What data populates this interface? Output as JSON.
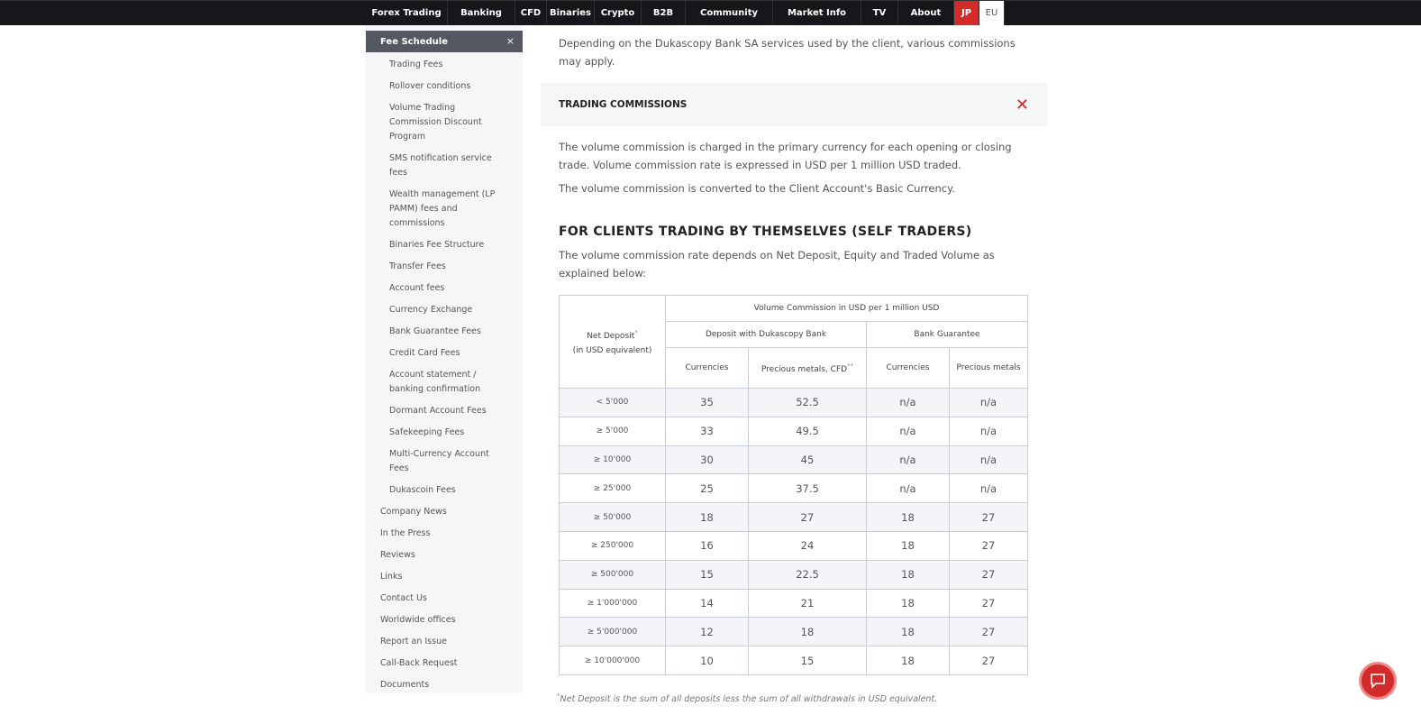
{
  "nav": [
    "Forex Trading",
    "Banking",
    "CFD",
    "Binaries",
    "Crypto",
    "B2B",
    "Community",
    "Market Info",
    "TV",
    "About",
    "JP",
    "EU"
  ],
  "sidebar": {
    "section": "Fee Schedule",
    "close": "×",
    "sub": [
      "Trading Fees",
      "Rollover conditions",
      "Volume Trading Commission Discount Program",
      "SMS notification service fees",
      "Wealth management (LP PAMM) fees and commissions",
      "Binaries Fee Structure",
      "Transfer Fees",
      "Account fees",
      "Currency Exchange",
      "Bank Guarantee Fees",
      "Credit Card Fees",
      "Account statement / banking confirmation",
      "Dormant Account Fees",
      "Safekeeping Fees",
      "Multi-Currency Account Fees",
      "Dukascoin Fees"
    ],
    "top": [
      "Company News",
      "In the Press",
      "Reviews",
      "Links",
      "Contact Us",
      "Worldwide offices",
      "Report an Issue",
      "Call-Back Request",
      "Documents"
    ]
  },
  "intro": "Depending on the Dukascopy Bank SA services used by the client, various commissions may apply.",
  "accordion": {
    "title": "TRADING COMMISSIONS"
  },
  "p1": "The volume commission is charged in the primary currency for each opening or closing trade. Volume commission rate is expressed in USD per 1 million USD traded.",
  "p2": "The volume commission is converted to the Client Account's Basic Currency.",
  "heading": "FOR CLIENTS TRADING BY THEMSELVES (SELF TRADERS)",
  "p3": "The volume commission rate depends on Net Deposit, Equity and Traded Volume as explained below:",
  "table": {
    "h_nd": "Net Deposit",
    "h_nd_sup": "*",
    "h_nd2": "(in USD equivalent)",
    "h_vc": "Volume Commission in USD per 1 million USD",
    "h_dep": "Deposit with Dukascopy Bank",
    "h_bg": "Bank Guarantee",
    "h_cur": "Currencies",
    "h_pm": "Precious metals, CFD",
    "h_pm_sup": "**",
    "h_cur2": "Currencies",
    "h_pm2": "Precious metals",
    "rows": [
      [
        "< 5'000",
        "35",
        "52.5",
        "n/a",
        "n/a"
      ],
      [
        "≥ 5'000",
        "33",
        "49.5",
        "n/a",
        "n/a"
      ],
      [
        "≥ 10'000",
        "30",
        "45",
        "n/a",
        "n/a"
      ],
      [
        "≥ 25'000",
        "25",
        "37.5",
        "n/a",
        "n/a"
      ],
      [
        "≥ 50'000",
        "18",
        "27",
        "18",
        "27"
      ],
      [
        "≥ 250'000",
        "16",
        "24",
        "18",
        "27"
      ],
      [
        "≥ 500'000",
        "15",
        "22.5",
        "18",
        "27"
      ],
      [
        "≥ 1'000'000",
        "14",
        "21",
        "18",
        "27"
      ],
      [
        "≥ 5'000'000",
        "12",
        "18",
        "18",
        "27"
      ],
      [
        "≥ 10'000'000",
        "10",
        "15",
        "18",
        "27"
      ]
    ]
  },
  "footnote_mark": "*",
  "footnote": "Net Deposit is the sum of all deposits less the sum of all withdrawals in USD equivalent."
}
